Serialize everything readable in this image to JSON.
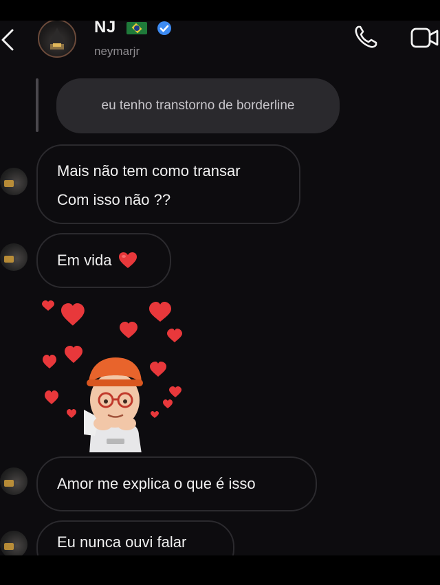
{
  "header": {
    "name": "NJ",
    "handle": "neymarjr"
  },
  "icons": {
    "back": "chevron-left-icon",
    "call": "phone-icon",
    "video": "video-camera-icon",
    "verified": "verified-badge-icon",
    "flag": "brazil-flag-icon"
  },
  "reply": {
    "text": "eu tenho transtorno de borderline"
  },
  "messages": [
    {
      "lines": [
        "Mais não tem como transar",
        "Com isso não ??"
      ]
    },
    {
      "text": "Em vida",
      "emoji": "red-heart"
    },
    {
      "sticker": "memoji-with-hearts"
    },
    {
      "text": "Amor me explica o que é isso"
    },
    {
      "text": "Eu nunca ouvi falar"
    }
  ],
  "colors": {
    "background": "#0d0c0f",
    "bubble_border": "#2b2a2e",
    "reply_bubble": "#2a292d",
    "text": "#f0f0f0",
    "verified_blue": "#3d8bf2",
    "heart_red": "#e8383b"
  }
}
